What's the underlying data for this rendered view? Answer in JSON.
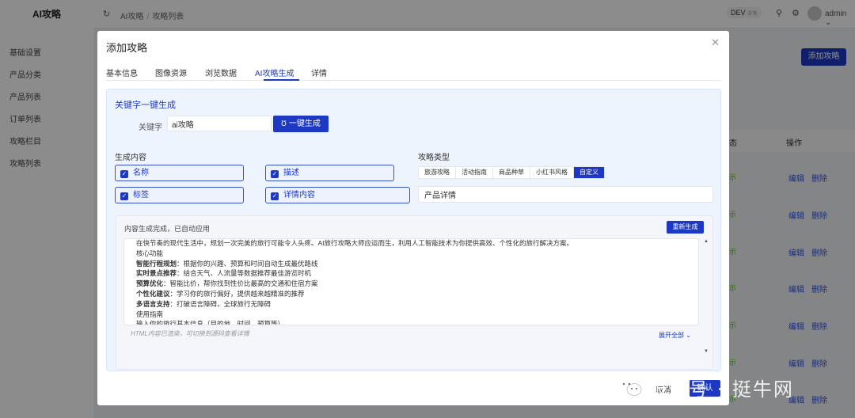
{
  "app": {
    "logo": "AI攻略",
    "menu": [
      "基础设置",
      "产品分类",
      "产品列表",
      "订单列表",
      "攻略栏目",
      "攻略列表"
    ]
  },
  "topbar": {
    "breadcrumbs": [
      "AI攻略",
      "攻略列表"
    ],
    "env": "DEV",
    "env_sub": "正常",
    "username": "admin"
  },
  "page": {
    "add_button": "添加攻略",
    "column_partial": "态",
    "column_ops": "操作",
    "edit": "编辑",
    "delete": "删除"
  },
  "modal": {
    "title": "添加攻略",
    "tabs": [
      "基本信息",
      "图像资源",
      "浏览数据",
      "AI攻略生成",
      "详情"
    ],
    "active_tab": "AI攻略生成",
    "section_title": "关键字一键生成",
    "keyword_label": "关键字",
    "keyword_value": "ai攻略",
    "generate_button": "一键生成",
    "content_label": "生成内容",
    "options": [
      "名称",
      "描述",
      "标签",
      "详情内容"
    ],
    "type_label": "攻略类型",
    "types": [
      "旅游攻略",
      "活动指南",
      "商品种草",
      "小红书风格",
      "自定义"
    ],
    "active_type": "自定义",
    "type_input_value": "产品详情",
    "status": "内容生成完成，已自动应用",
    "regenerate": "重新生成",
    "content_lines": [
      {
        "bold": "",
        "text": "在快节奏的现代生活中，规划一次完美的旅行可能令人头疼。AI旅行攻略大师应运而生，利用人工智能技术为你提供高效、个性化的旅行解决方案。"
      },
      {
        "bold": "",
        "text": "核心功能"
      },
      {
        "bold": "智能行程规划",
        "text": "：根据你的兴趣、预算和时间自动生成最优路线"
      },
      {
        "bold": "实时景点推荐",
        "text": "：结合天气、人流量等数据推荐最佳游览时机"
      },
      {
        "bold": "预算优化",
        "text": "：智能比价，帮你找到性价比最高的交通和住宿方案"
      },
      {
        "bold": "个性化建议",
        "text": "：学习你的旅行偏好，提供越来越精准的推荐"
      },
      {
        "bold": "多语言支持",
        "text": "：打破语言障碍，全球旅行无障碍"
      },
      {
        "bold": "",
        "text": "使用指南"
      },
      {
        "bold": "",
        "text": "输入你的旅行基本信息（目的地、时间、预算等）"
      }
    ],
    "render_note": "HTML内容已渲染，可切换到源码查看详情",
    "expand": "展开全部",
    "cancel": "取消",
    "confirm": "确认"
  },
  "watermark": "服务号 · 挺牛网"
}
